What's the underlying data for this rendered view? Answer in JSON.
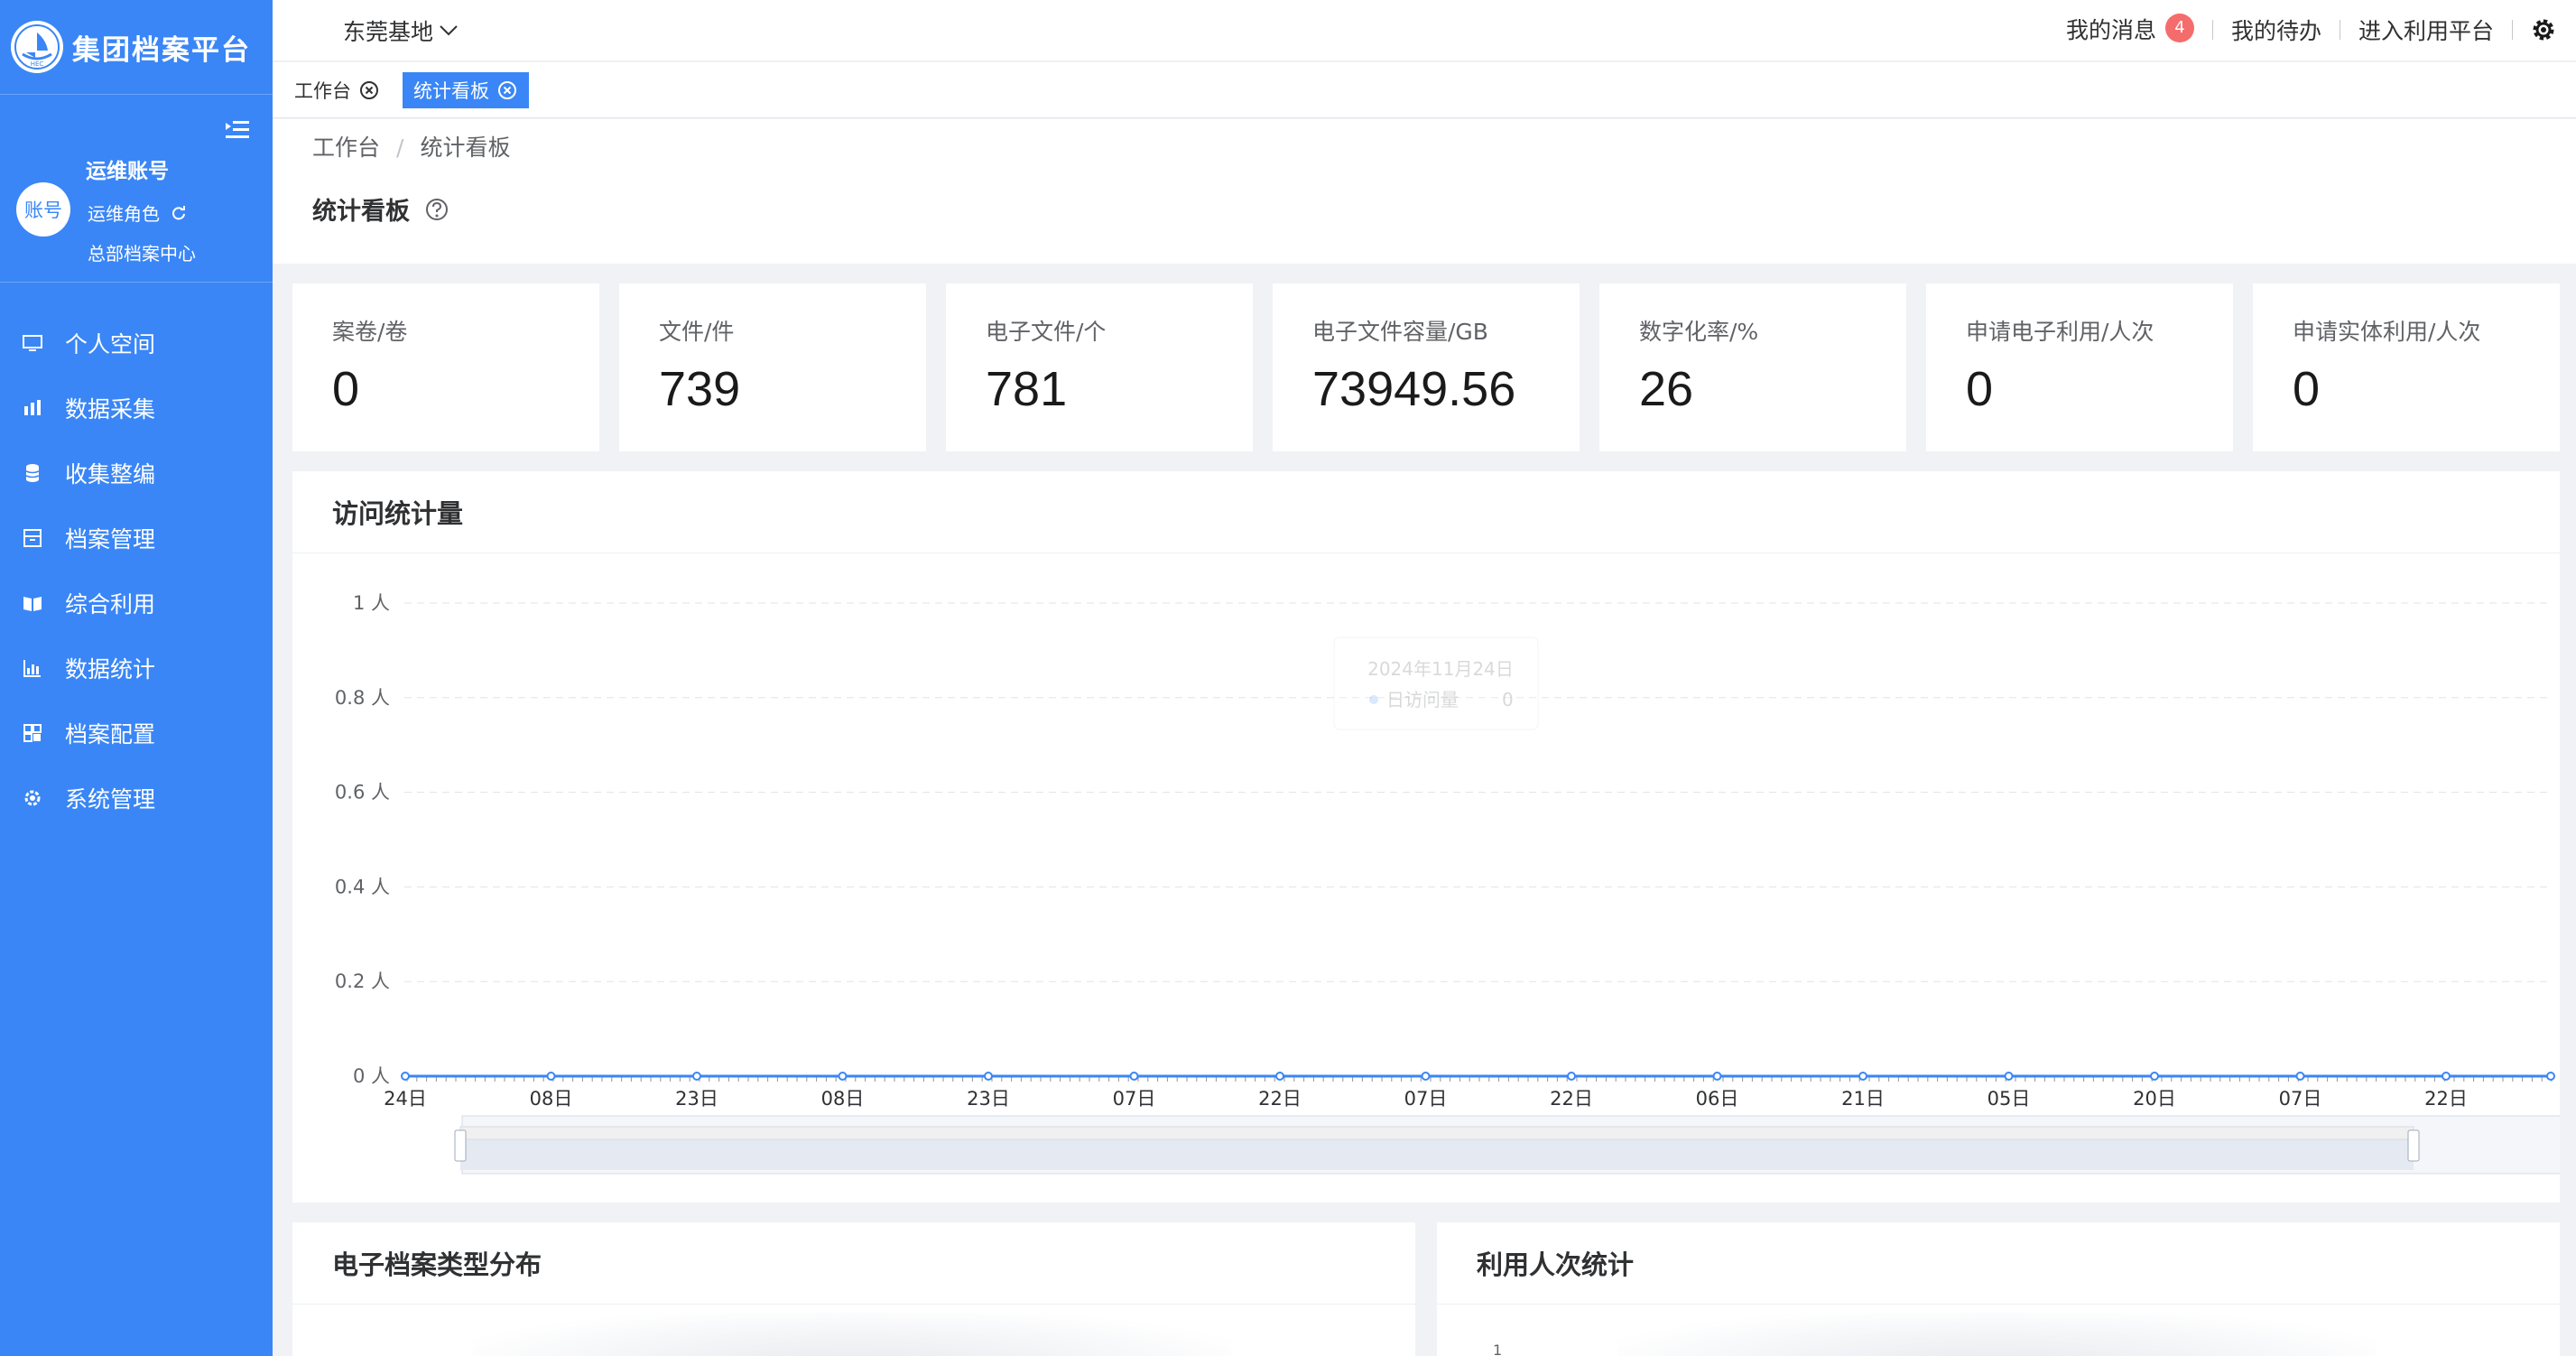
{
  "app": {
    "title": "集团档案平台",
    "logo_sub": "HEC"
  },
  "user": {
    "avatar": "账号",
    "name": "运维账号",
    "role": "运维角色",
    "org": "总部档案中心"
  },
  "nav": [
    {
      "label": "个人空间",
      "icon": "monitor-icon"
    },
    {
      "label": "数据采集",
      "icon": "data-collect-icon"
    },
    {
      "label": "收集整编",
      "icon": "database-icon"
    },
    {
      "label": "档案管理",
      "icon": "archive-box-icon"
    },
    {
      "label": "综合利用",
      "icon": "book-open-icon"
    },
    {
      "label": "数据统计",
      "icon": "bar-chart-icon"
    },
    {
      "label": "档案配置",
      "icon": "grid-config-icon"
    },
    {
      "label": "系统管理",
      "icon": "gear-settings-icon"
    }
  ],
  "header": {
    "base": "东莞基地",
    "messages": "我的消息",
    "message_count": "4",
    "todo": "我的待办",
    "enter_platform": "进入利用平台"
  },
  "tabs": [
    {
      "label": "工作台",
      "active": false
    },
    {
      "label": "统计看板",
      "active": true
    }
  ],
  "breadcrumb": {
    "home": "工作台",
    "separator": "/",
    "current": "统计看板"
  },
  "page_title": "统计看板",
  "stats": [
    {
      "label": "案卷/卷",
      "value": "0"
    },
    {
      "label": "文件/件",
      "value": "739"
    },
    {
      "label": "电子文件/个",
      "value": "781"
    },
    {
      "label": "电子文件容量/GB",
      "value": "73949.56"
    },
    {
      "label": "数字化率/%",
      "value": "26"
    },
    {
      "label": "申请电子利用/人次",
      "value": "0"
    },
    {
      "label": "申请实体利用/人次",
      "value": "0"
    }
  ],
  "visit_panel_title": "访问统计量",
  "tooltip": {
    "date": "2024年11月24日",
    "series": "日访问量",
    "value": "0"
  },
  "chart_data": {
    "type": "line",
    "title": "访问统计量",
    "y_unit": "人",
    "ylim": [
      0,
      1
    ],
    "y_ticks": [
      "0 人",
      "0.2 人",
      "0.4 人",
      "0.6 人",
      "0.8 人",
      "1 人"
    ],
    "categories": [
      "24日",
      "08日",
      "23日",
      "08日",
      "23日",
      "07日",
      "22日",
      "07日",
      "22日",
      "06日",
      "21日",
      "05日",
      "20日",
      "07日",
      "22日"
    ],
    "series": [
      {
        "name": "日访问量",
        "values": [
          0,
          0,
          0,
          0,
          0,
          0,
          0,
          0,
          0,
          0,
          0,
          0,
          0,
          0,
          0,
          0
        ]
      }
    ],
    "grid": true,
    "color": "#3a86f6"
  },
  "type_panel_title": "电子档案类型分布",
  "usage_panel_title": "利用人次统计",
  "usage_tick": "1"
}
